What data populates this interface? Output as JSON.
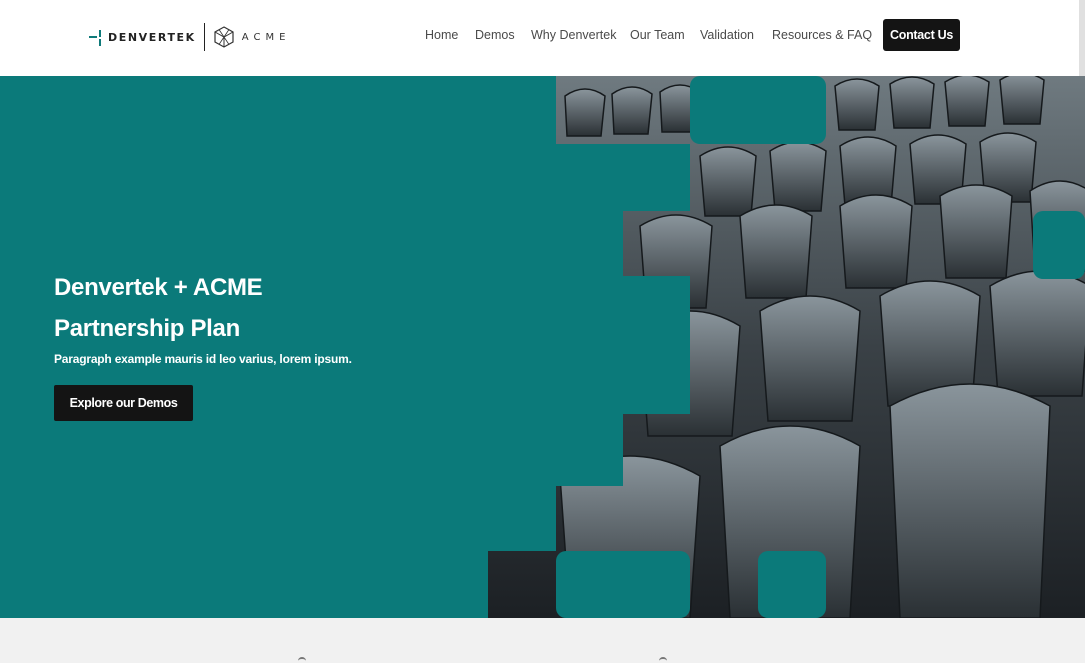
{
  "header": {
    "logo_primary": "DENVERTEK",
    "logo_partner": "ACME",
    "nav": [
      {
        "label": "Home"
      },
      {
        "label": "Demos"
      },
      {
        "label": "Why Denvertek"
      },
      {
        "label": "Our Team"
      },
      {
        "label": "Validation"
      },
      {
        "label": "Resources & FAQ"
      }
    ],
    "cta_label": "Contact Us"
  },
  "hero": {
    "title_line1": "Denvertek + ACME",
    "title_line2": "Partnership Plan",
    "subtitle": "Paragraph example mauris id leo varius, lorem ipsum.",
    "button_label": "Explore our Demos",
    "image_subject": "rows of dark chairs in an empty auditorium"
  },
  "colors": {
    "teal": "#0b7a7a",
    "button_dark": "#141414",
    "header_bg": "#ffffff",
    "section_bg": "#f1f1f1"
  }
}
